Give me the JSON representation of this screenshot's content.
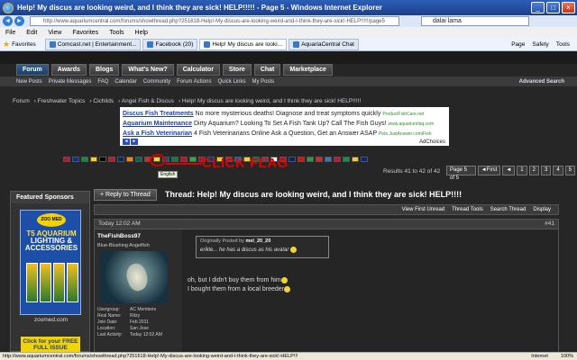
{
  "window": {
    "title": "Help! My discus are looking weird, and I think they are sick! HELP!!!!! - Page 5 - Windows Internet Explorer",
    "url": "http://www.aquariumcentral.com/forums/showthread.php?251618-Help!-My-discus-are-looking-weird-and-I-think-they-are-sick!-HELP!!!!!/page5",
    "search_value": "dalai lama"
  },
  "menu": [
    "File",
    "Edit",
    "View",
    "Favorites",
    "Tools",
    "Help"
  ],
  "favorites_label": "Favorites",
  "browser_tabs": [
    {
      "label": "Comcast.net | Entertainment...",
      "active": false
    },
    {
      "label": "Facebook (20)",
      "active": false
    },
    {
      "label": "Help! My discus are looki...",
      "active": true
    },
    {
      "label": "AquariaCentral Chat",
      "active": false
    }
  ],
  "browser_tools": [
    "Page",
    "Safety",
    "Tools"
  ],
  "site_nav": [
    {
      "label": "Forum",
      "active": true
    },
    {
      "label": "Awards",
      "active": false
    },
    {
      "label": "Blogs",
      "active": false
    },
    {
      "label": "What's New?",
      "active": false
    },
    {
      "label": "Calculator",
      "active": false
    },
    {
      "label": "Store",
      "active": false
    },
    {
      "label": "Chat",
      "active": false
    },
    {
      "label": "Marketplace",
      "active": false
    }
  ],
  "sub_nav": [
    "New Posts",
    "Private Messages",
    "FAQ",
    "Calendar",
    "Community",
    "Forum Actions",
    "Quick Links",
    "My Posts"
  ],
  "advanced_search": "Advanced Search",
  "breadcrumb": [
    "Forum",
    "Freshwater Topics",
    "Cichlids",
    "Angel Fish & Discus",
    "Help! My discus are looking weird, and I think they are sick! HELP!!!!!"
  ],
  "ads": [
    {
      "title": "Discus Fish Treatments",
      "text": "No more mysterious deaths! Diagnose and treat symptoms quickly",
      "url": "ProductFishCare.net"
    },
    {
      "title": "Aquarium Maintenance",
      "text": "Dirty Aquarium? Looking To Set A Fish Tank Up? Call The Fish Guys!",
      "url": "www.aquariumfaq.com"
    },
    {
      "title": "Ask a Fish Veterinarian",
      "text": "4 Fish Veterinarians Online Ask a Question, Get an Answer ASAP",
      "url": "Pets.JustAnswer.com/Fish"
    }
  ],
  "adchoices": "AdChoices",
  "flag_colors": [
    "#c8102e",
    "#0033a0",
    "#009739",
    "#ffd100",
    "#000000",
    "#ce1126",
    "#002868",
    "#ff8200",
    "#006a4e",
    "#d52b1e",
    "#fcd116",
    "#0055a4",
    "#00843d",
    "#e4002b",
    "#1eb53a",
    "#bf0a30",
    "#003893",
    "#ffcc00",
    "#dc143c",
    "#0072c6",
    "#f7d618",
    "#007a3d",
    "#b22234",
    "#ffffff",
    "#c60c30",
    "#00247d",
    "#fe0000",
    "#239f40",
    "#ee1c25",
    "#3a75c4",
    "#d21034",
    "#009a44",
    "#ffc72c",
    "#002395"
  ],
  "flag_tooltip": "English",
  "annotation": "CLICK FLAG",
  "results_text": "Results 41 to 42 of 42",
  "pagination": [
    "Page 5 of 5",
    "◄First",
    "◄",
    "1",
    "2",
    "3",
    "4",
    "5"
  ],
  "sidebar": {
    "title": "Featured Sponsors",
    "ad_logo": "ZOO MED",
    "ad_line1": "T5 AQUARIUM",
    "ad_line2": "LIGHTING &",
    "ad_line3": "ACCESSORIES",
    "url": "zoomed.com",
    "button": "Click for your FREE FULL ISSUE"
  },
  "reply_button": "+ Reply to Thread",
  "thread_title": "Thread: Help! My discus are looking weird, and I think they are sick! HELP!!!!",
  "thread_tools": [
    "View First Unread",
    "Thread Tools",
    "Search Thread",
    "Display"
  ],
  "post": {
    "date": "Today 12:02 AM",
    "number": "#41",
    "username": "TheFishBoss97",
    "user_title": "Blue-Blushing Angelfish",
    "stats": [
      {
        "k": "Usergroup:",
        "v": "AC Members"
      },
      {
        "k": "Real Name:",
        "v": "Ritzy"
      },
      {
        "k": "Join Date:",
        "v": "Feb 2011"
      },
      {
        "k": "Location:",
        "v": "San Jose"
      },
      {
        "k": "Last Activity:",
        "v": "Today 12:02 AM"
      }
    ],
    "quote_prefix": "Originally Posted by",
    "quote_author": "mel_20_20",
    "quote_text": "erikle... he has a discus as his avatar",
    "line1": "oh, but I didn't buy them from him",
    "line2": "I bought them from a local breeder"
  },
  "status": {
    "url": "http://www.aquariumcentral.com/forums/showthread.php?251618-Help!-My-discus-are-looking-weird-and-I-think-they-are-sick!-HELP!!!",
    "zone": "Internet",
    "zoom": "100%"
  }
}
